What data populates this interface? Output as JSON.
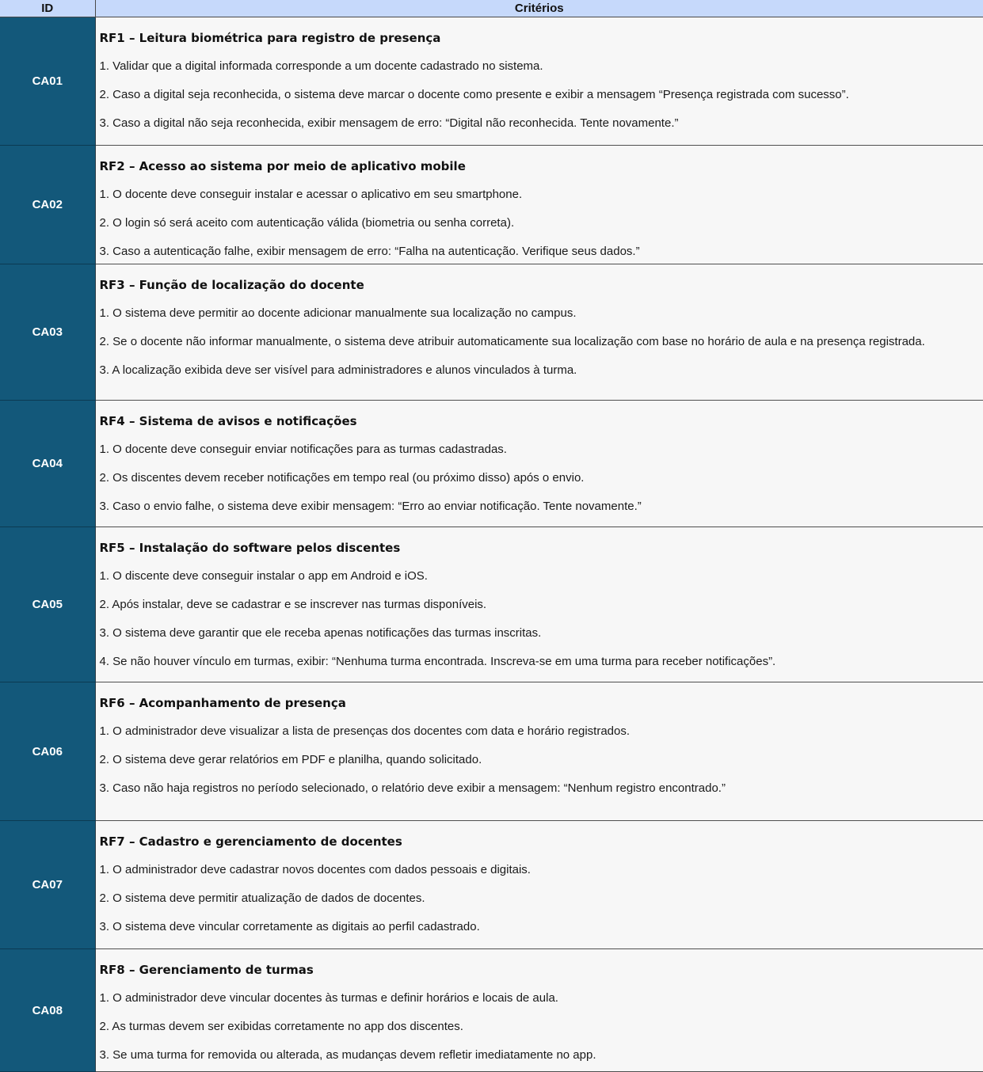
{
  "header": {
    "id_label": "ID",
    "criteria_label": "Critérios"
  },
  "rows": [
    {
      "id": "CA01",
      "title": "RF1 – Leitura biométrica para registro de presença",
      "items": [
        "1. Validar que a digital informada corresponde a um docente cadastrado no sistema.",
        "2. Caso a digital seja reconhecida, o sistema deve marcar o docente como presente e exibir a mensagem “Presença registrada com sucesso”.",
        "3. Caso a digital não seja reconhecida, exibir mensagem de erro: “Digital não reconhecida. Tente novamente.”"
      ]
    },
    {
      "id": "CA02",
      "title": "RF2 – Acesso ao sistema por meio de aplicativo mobile",
      "items": [
        "1. O docente deve conseguir instalar e acessar o aplicativo em seu smartphone.",
        "2. O login só será aceito com autenticação válida (biometria ou senha correta).",
        "3. Caso a autenticação falhe, exibir mensagem de erro: “Falha na autenticação. Verifique seus dados.”"
      ]
    },
    {
      "id": "CA03",
      "title": "RF3 – Função de localização do docente",
      "items": [
        "1. O sistema deve permitir ao docente adicionar manualmente sua localização no campus.",
        "2. Se o docente não informar manualmente, o sistema deve atribuir automaticamente sua localização com base no horário de aula e na presença registrada.",
        "3. A localização exibida deve ser visível para administradores e alunos vinculados à turma."
      ]
    },
    {
      "id": "CA04",
      "title": "RF4 – Sistema de avisos e notificações",
      "items": [
        "1. O docente deve conseguir enviar notificações para as turmas cadastradas.",
        "2. Os discentes devem receber notificações em tempo real (ou próximo disso) após o envio.",
        "3. Caso o envio falhe, o sistema deve exibir mensagem: “Erro ao enviar notificação. Tente novamente.”"
      ]
    },
    {
      "id": "CA05",
      "title": "RF5 – Instalação do software pelos discentes",
      "items": [
        "1. O discente deve conseguir instalar o app em Android e iOS.",
        "2. Após instalar, deve se cadastrar e se inscrever nas turmas disponíveis.",
        "3. O sistema deve garantir que ele receba apenas notificações das turmas inscritas.",
        "4. Se não houver vínculo em turmas, exibir: “Nenhuma turma encontrada. Inscreva-se em uma turma para receber notificações”."
      ]
    },
    {
      "id": "CA06",
      "title": "RF6 – Acompanhamento de presença",
      "items": [
        "1. O administrador deve visualizar a lista de presenças dos docentes com data e horário registrados.",
        "2. O sistema deve gerar relatórios em PDF e planilha, quando solicitado.",
        "3. Caso não haja registros no período selecionado, o relatório deve exibir a mensagem: “Nenhum registro encontrado.”"
      ]
    },
    {
      "id": "CA07",
      "title": "RF7 – Cadastro e gerenciamento de docentes",
      "items": [
        "1. O administrador deve cadastrar novos docentes com dados pessoais e digitais.",
        "2. O sistema deve permitir atualização de dados de docentes.",
        "3. O sistema deve vincular corretamente as digitais ao perfil cadastrado."
      ]
    },
    {
      "id": "CA08",
      "title": "RF8 – Gerenciamento de turmas",
      "items": [
        "1. O administrador deve vincular docentes às turmas e definir horários e locais de aula.",
        "2. As turmas devem ser exibidas corretamente no app dos discentes.",
        "3. Se uma turma for removida ou alterada, as mudanças devem refletir imediatamente no app."
      ]
    }
  ]
}
